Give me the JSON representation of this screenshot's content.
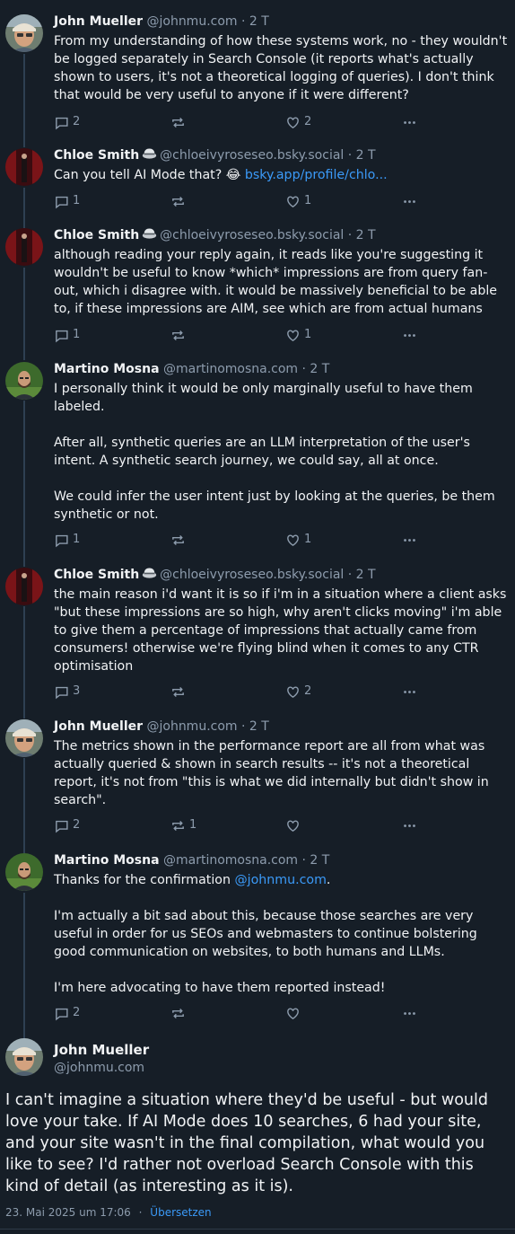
{
  "icons": {
    "reply": "comment-icon",
    "repost": "repost-icon",
    "like": "heart-icon",
    "more": "more-icon",
    "badge": "cap-badge-icon"
  },
  "colors": {
    "background": "#161e27",
    "text": "#f1f3f5",
    "muted": "#8d9cad",
    "link": "#3b9af8",
    "thread_line": "#2e4052"
  },
  "replies": [
    {
      "name": "John Mueller",
      "handle": "@johnmu.com",
      "time": "· 2 T",
      "text": [
        "From my understanding of how these systems work, no - they wouldn't be logged separately in Search Console (it reports what's actually shown to users, it's not a theoretical logging of queries). I don't think that would be very useful to anyone if it were different?"
      ],
      "replies": "2",
      "reposts": "",
      "likes": "2"
    },
    {
      "name": "Chloe Smith",
      "handle": "@chloeivyroseseo.bsky.social",
      "time": "· 2 T",
      "text_prefix": "Can you tell AI Mode that? 😂 ",
      "link": "bsky.app/profile/chlo...",
      "replies": "1",
      "reposts": "",
      "likes": "1"
    },
    {
      "name": "Chloe Smith",
      "handle": "@chloeivyroseseo.bsky.social",
      "time": "· 2 T",
      "text": [
        "although reading your reply again, it reads like you're suggesting it wouldn't be useful to know *which* impressions are from query fan-out, which i disagree with. it would be massively beneficial to be able to, if these impressions are AIM, see which are from actual humans"
      ],
      "replies": "1",
      "reposts": "",
      "likes": "1"
    },
    {
      "name": "Martino Mosna",
      "handle": "@martinomosna.com",
      "time": "· 2 T",
      "text": [
        "I personally think it would be only marginally useful to have them labeled.",
        "",
        "After all, synthetic queries are an LLM interpretation of the user's intent. A synthetic search journey, we could say, all at once.",
        "",
        "We could infer the user intent just by looking at the queries, be them synthetic or not."
      ],
      "replies": "1",
      "reposts": "",
      "likes": "1"
    },
    {
      "name": "Chloe Smith",
      "handle": "@chloeivyroseseo.bsky.social",
      "time": "· 2 T",
      "text": [
        "the main reason i'd want it is so if i'm in a situation where a client asks \"but these impressions are so high, why aren't clicks moving\" i'm able to give them a percentage of impressions that actually came from consumers! otherwise we're flying blind when it comes to any CTR optimisation"
      ],
      "replies": "3",
      "reposts": "",
      "likes": "2"
    },
    {
      "name": "John Mueller",
      "handle": "@johnmu.com",
      "time": "· 2 T",
      "text": [
        "The metrics shown in the performance report are all from what was actually queried & shown in search results -- it's not a theoretical report, it's not from \"this is what we did internally but didn't show in search\"."
      ],
      "replies": "2",
      "reposts": "1",
      "likes": ""
    },
    {
      "name": "Martino Mosna",
      "handle": "@martinomosna.com",
      "time": "· 2 T",
      "text_prefix": "Thanks for the confirmation ",
      "link": "@johnmu.com",
      "text_suffix": ".",
      "text_more": [
        "",
        "I'm actually a bit sad about this, because those searches are very useful in order for us SEOs and webmasters to continue bolstering good communication on websites, to both humans and LLMs.",
        "",
        "I'm here advocating to have them reported instead!"
      ],
      "replies": "2",
      "reposts": "",
      "likes": ""
    }
  ],
  "main_post": {
    "name": "John Mueller",
    "handle": "@johnmu.com",
    "text": "I can't imagine a situation where they'd be useful - but would love your take. If AI Mode does 10 searches, 6 had your site, and your site wasn't in the final compilation, what would you like to see? I'd rather not overload Search Console with this kind of detail (as interesting as it is).",
    "timestamp": "23. Mai 2025 um 17:06",
    "separator": "·",
    "translate": "Übersetzen"
  }
}
